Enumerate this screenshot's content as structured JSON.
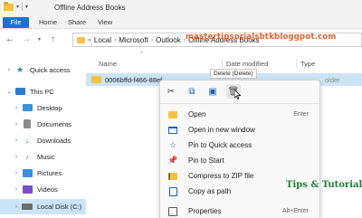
{
  "window": {
    "title": "Offline Address Books"
  },
  "ribbon": {
    "tabs": [
      "File",
      "Home",
      "Share",
      "View"
    ]
  },
  "address": {
    "segments": [
      "Local",
      "Microsoft",
      "Outlook",
      "Offline Address Books"
    ],
    "prefix": "«"
  },
  "sidebar": {
    "items": [
      {
        "label": "Quick access",
        "icon": "star-icon"
      },
      {
        "label": "This PC",
        "icon": "pc-icon"
      },
      {
        "label": "Desktop",
        "icon": "desktop-icon"
      },
      {
        "label": "Documents",
        "icon": "documents-icon"
      },
      {
        "label": "Downloads",
        "icon": "downloads-icon"
      },
      {
        "label": "Music",
        "icon": "music-icon"
      },
      {
        "label": "Pictures",
        "icon": "pictures-icon"
      },
      {
        "label": "Videos",
        "icon": "videos-icon"
      },
      {
        "label": "Local Disk (C:)",
        "icon": "disk-icon"
      }
    ]
  },
  "columns": {
    "name": "Name",
    "date": "Date modified",
    "type": "Type"
  },
  "file": {
    "name": "0006bffd-f466-88ef-",
    "type": "older"
  },
  "watermark": "mastertipsorialsbtkbloggpot.com",
  "tooltip": "Delete (Delete)",
  "context_menu": {
    "quick_actions": [
      "cut",
      "copy",
      "rename",
      "delete"
    ],
    "items": [
      {
        "label": "Open",
        "shortcut": "Enter"
      },
      {
        "label": "Open in new window",
        "shortcut": ""
      },
      {
        "label": "Pin to Quick access",
        "shortcut": ""
      },
      {
        "label": "Pin to Start",
        "shortcut": ""
      },
      {
        "label": "Compress to ZIP file",
        "shortcut": ""
      },
      {
        "label": "Copy as path",
        "shortcut": ""
      },
      {
        "label": "Properties",
        "shortcut": "Alt+Enter"
      }
    ]
  },
  "overlay_text": "Tips & Tutorial",
  "colors": {
    "accent": "#1a73c8",
    "selection": "#cce4f7",
    "folder": "#f5c242",
    "watermark": "#e06030",
    "overlay": "#1e7d3a"
  }
}
